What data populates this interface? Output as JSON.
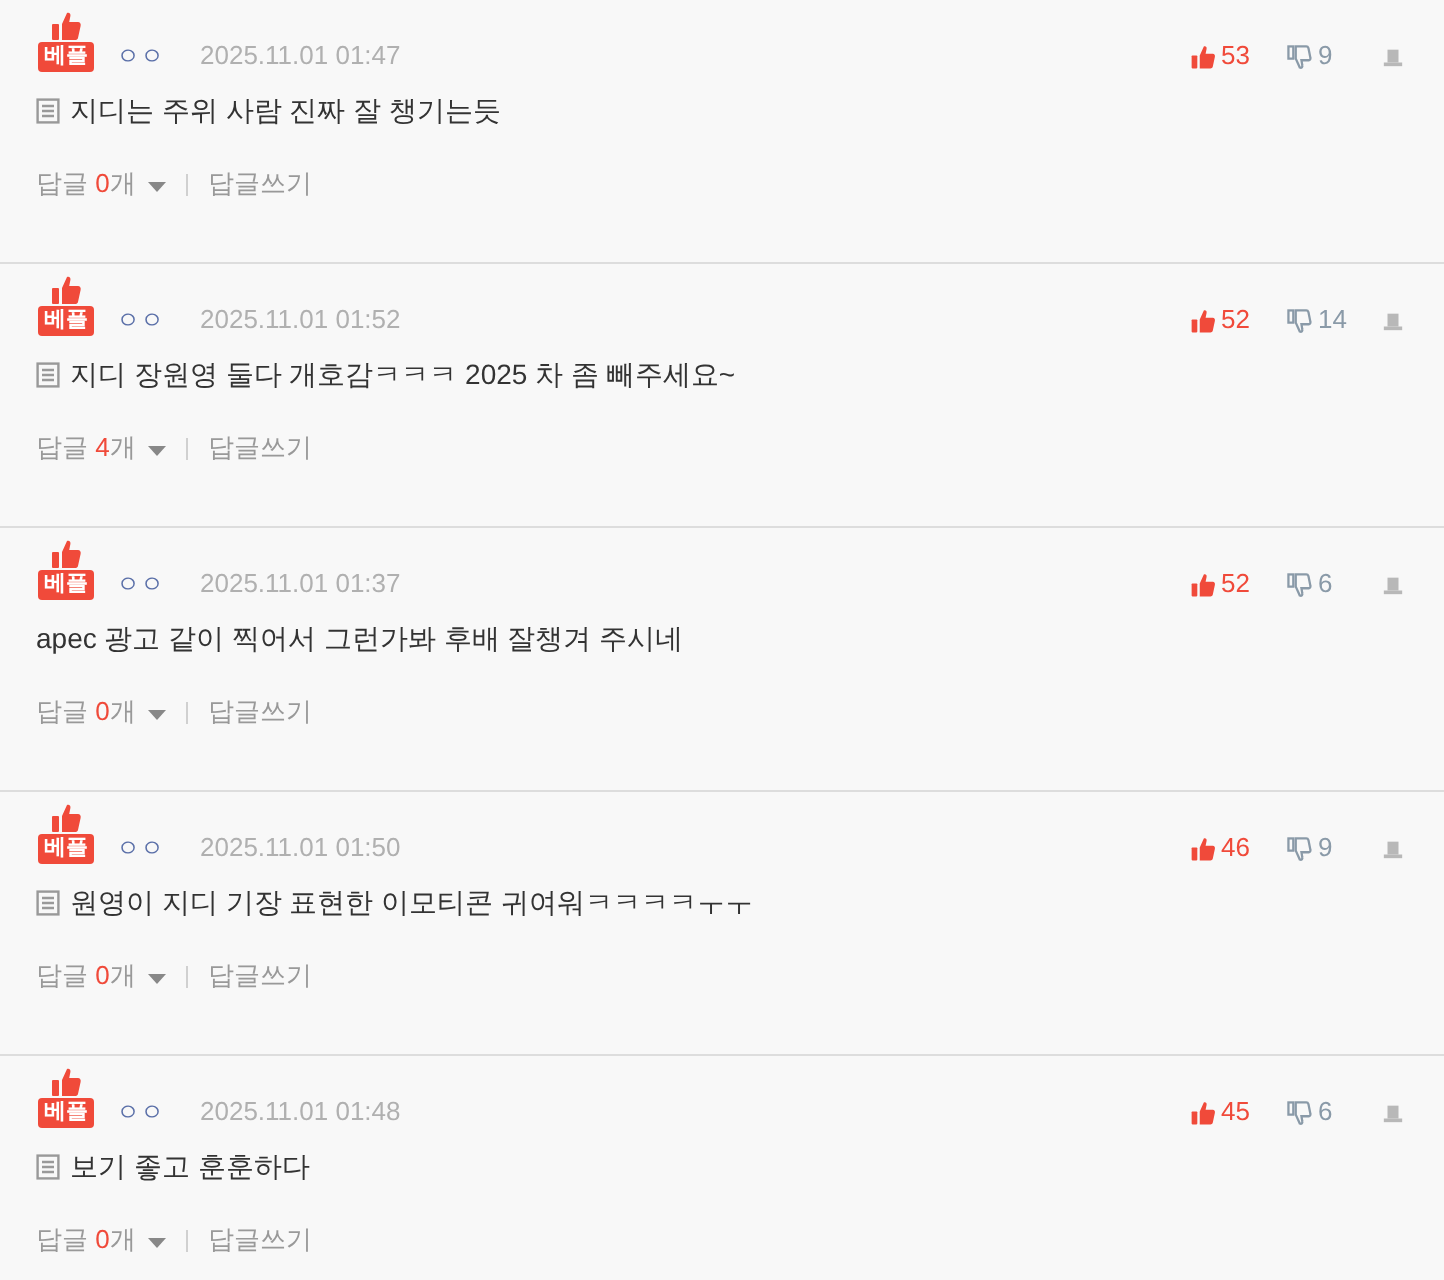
{
  "comments": [
    {
      "badge": "베플",
      "author": "ㅇㅇ",
      "date": "2025.11.01 01:47",
      "memo_icon": true,
      "text": "지디는 주위 사람 진짜 잘 챙기는듯",
      "likes": "53",
      "dislikes": "9",
      "reply_label": "답글",
      "reply_count": "0",
      "reply_unit": "개",
      "write_reply": "답글쓰기"
    },
    {
      "badge": "베플",
      "author": "ㅇㅇ",
      "date": "2025.11.01 01:52",
      "memo_icon": true,
      "text": "지디 장원영 둘다 개호감ㅋㅋㅋ 2025 차 좀 빼주세요~",
      "likes": "52",
      "dislikes": "14",
      "reply_label": "답글",
      "reply_count": "4",
      "reply_unit": "개",
      "write_reply": "답글쓰기"
    },
    {
      "badge": "베플",
      "author": "ㅇㅇ",
      "date": "2025.11.01 01:37",
      "memo_icon": false,
      "text": "apec 광고 같이 찍어서 그런가봐 후배 잘챙겨 주시네",
      "likes": "52",
      "dislikes": "6",
      "reply_label": "답글",
      "reply_count": "0",
      "reply_unit": "개",
      "write_reply": "답글쓰기"
    },
    {
      "badge": "베플",
      "author": "ㅇㅇ",
      "date": "2025.11.01 01:50",
      "memo_icon": true,
      "text": "원영이 지디 기장 표현한 이모티콘 귀여워ㅋㅋㅋㅋㅜㅜ",
      "likes": "46",
      "dislikes": "9",
      "reply_label": "답글",
      "reply_count": "0",
      "reply_unit": "개",
      "write_reply": "답글쓰기"
    },
    {
      "badge": "베플",
      "author": "ㅇㅇ",
      "date": "2025.11.01 01:48",
      "memo_icon": true,
      "text": "보기 좋고 훈훈하다",
      "likes": "45",
      "dislikes": "6",
      "reply_label": "답글",
      "reply_count": "0",
      "reply_unit": "개",
      "write_reply": "답글쓰기"
    }
  ]
}
